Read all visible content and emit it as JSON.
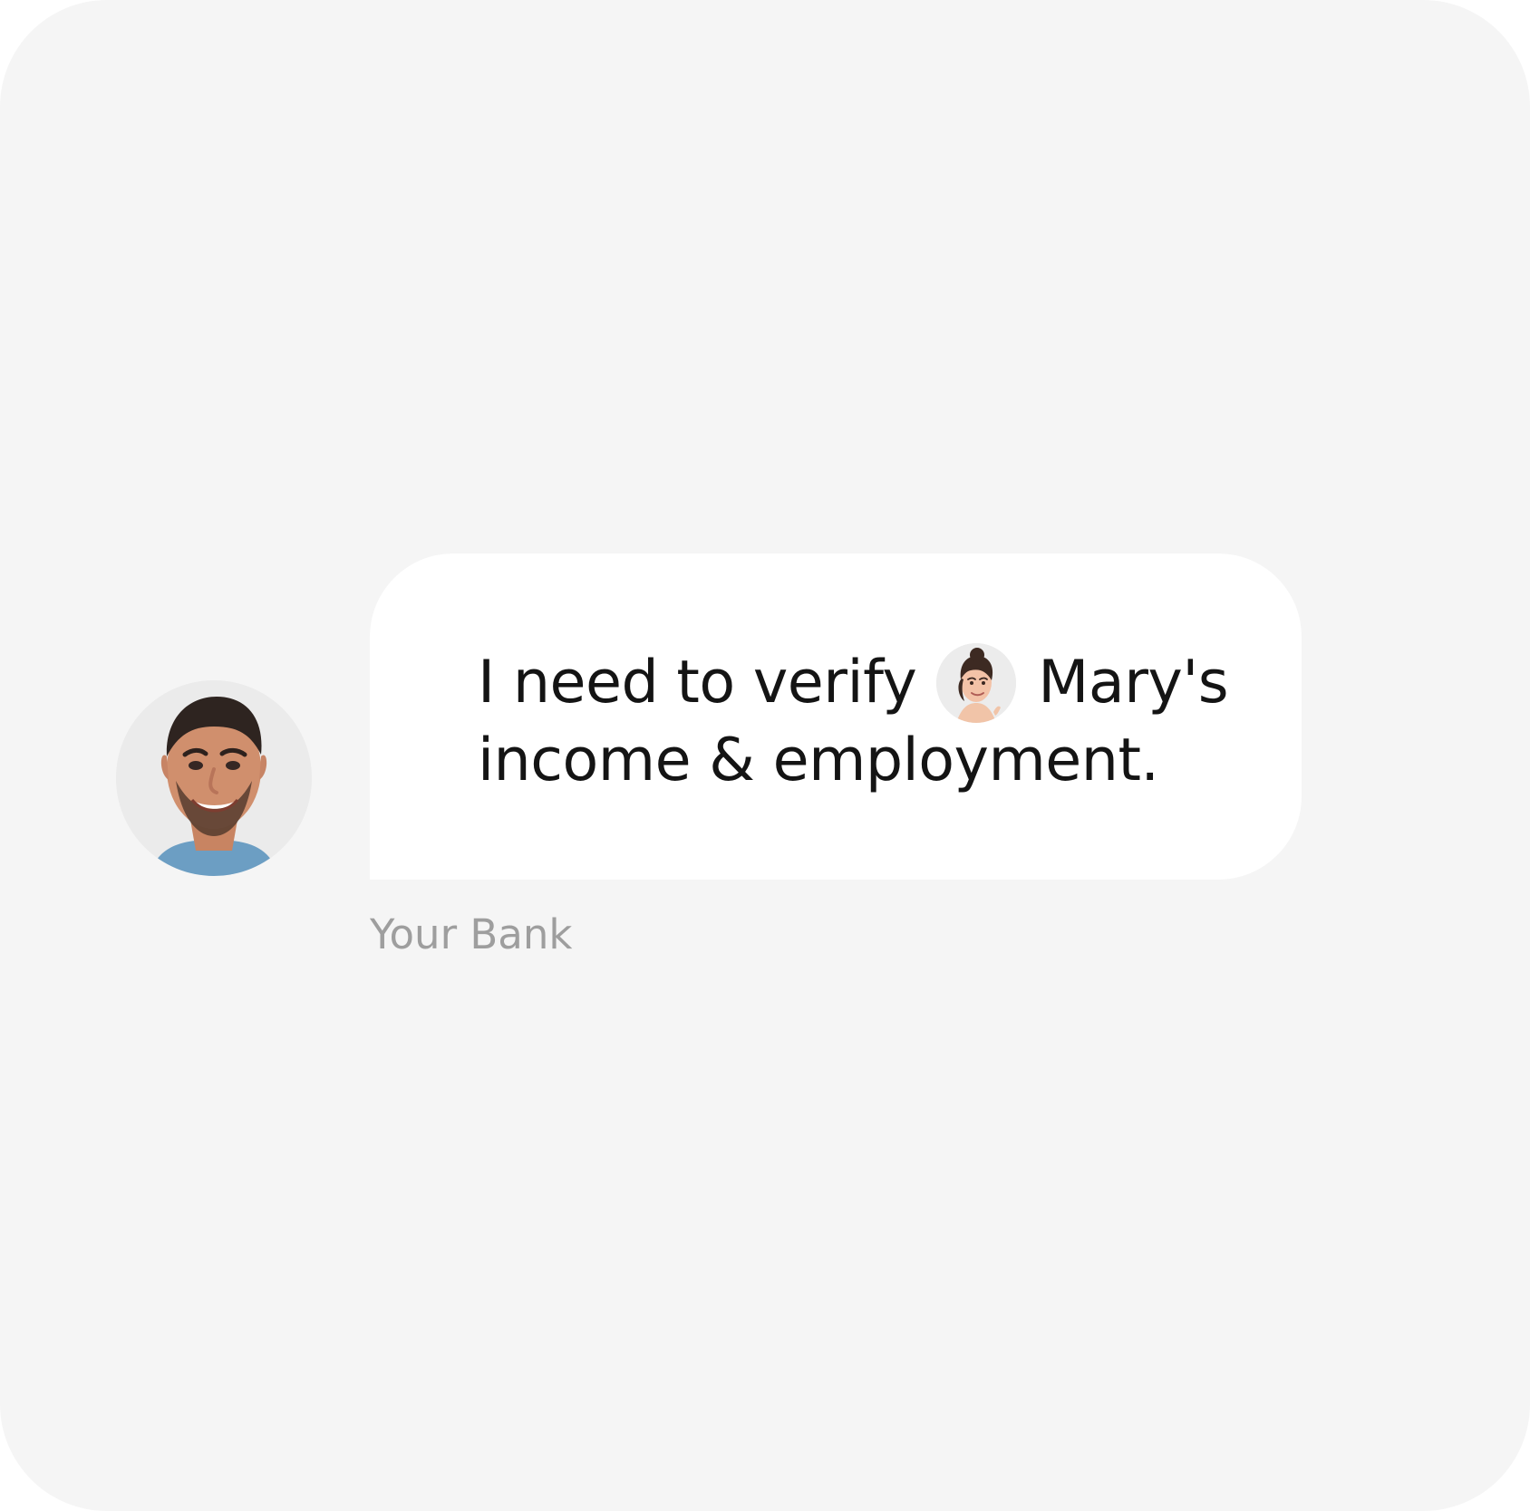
{
  "message": {
    "prefix": "I need to verify",
    "name": "Mary's",
    "suffix": "income & employment."
  },
  "sender": {
    "label": "Your Bank"
  },
  "icons": {
    "sender_avatar": "man-avatar-icon",
    "subject_avatar": "woman-avatar-icon"
  },
  "colors": {
    "background": "#f5f5f5",
    "bubble": "#ffffff",
    "message_text": "#141414",
    "sender_text": "#9e9e9e"
  }
}
